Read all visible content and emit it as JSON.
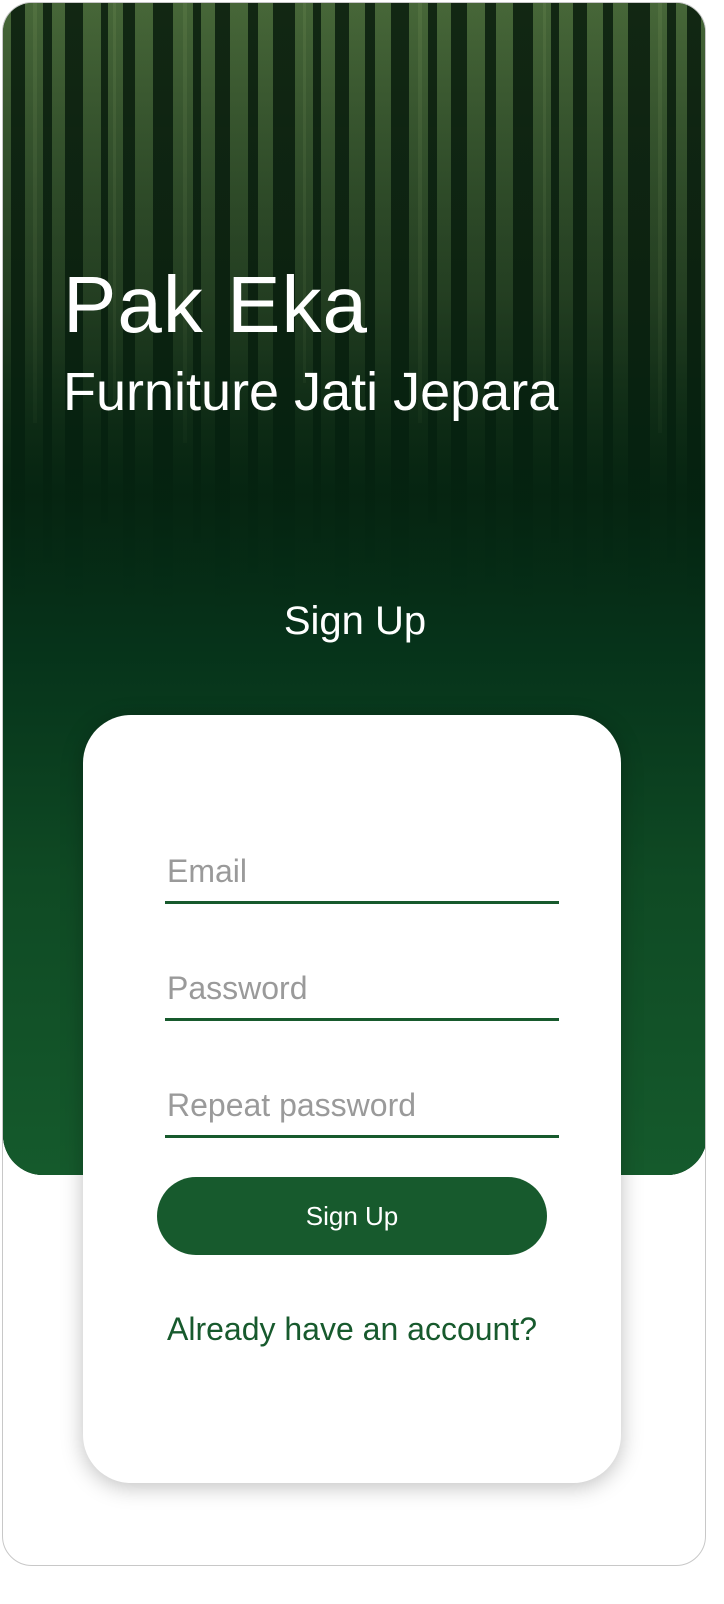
{
  "brand": {
    "title": "Pak Eka",
    "subtitle": "Furniture Jati Jepara"
  },
  "hero": {
    "heading": "Sign Up"
  },
  "form": {
    "email_placeholder": "Email",
    "password_placeholder": "Password",
    "repeat_password_placeholder": "Repeat password",
    "submit_label": "Sign Up",
    "login_link": "Already have an account?"
  },
  "colors": {
    "primary": "#175a2d",
    "hero_dark": "#06331a",
    "card_bg": "#ffffff",
    "placeholder": "#9a9a9a"
  }
}
